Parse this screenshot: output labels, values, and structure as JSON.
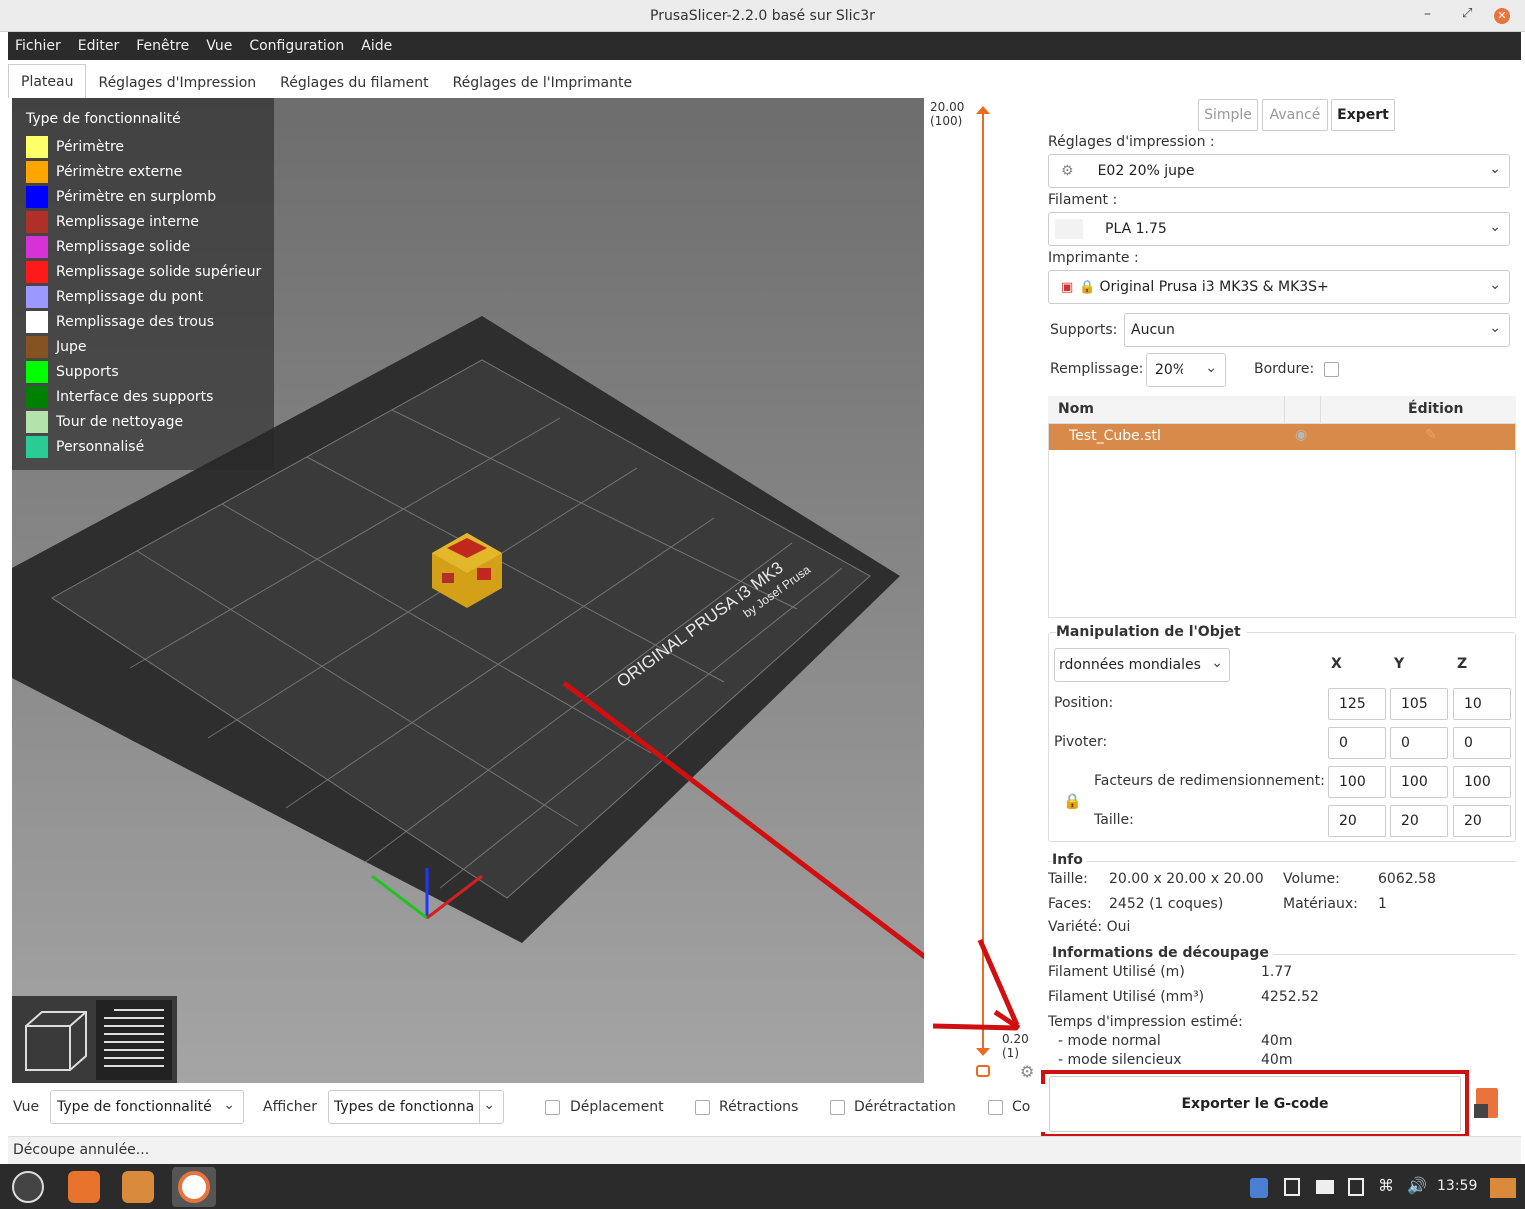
{
  "window": {
    "title": "PrusaSlicer-2.2.0 basé sur Slic3r",
    "min": "–",
    "max": "⤢",
    "close": "✕"
  },
  "menu": [
    "Fichier",
    "Editer",
    "Fenêtre",
    "Vue",
    "Configuration",
    "Aide"
  ],
  "tabs": [
    "Plateau",
    "Réglages d'Impression",
    "Réglages du filament",
    "Réglages de l'Imprimante"
  ],
  "legend": {
    "title": "Type de fonctionnalité",
    "items": [
      {
        "label": "Périmètre",
        "color": "#ffff66"
      },
      {
        "label": "Périmètre externe",
        "color": "#ffa500"
      },
      {
        "label": "Périmètre en surplomb",
        "color": "#0000ff"
      },
      {
        "label": "Remplissage interne",
        "color": "#b03029"
      },
      {
        "label": "Remplissage solide",
        "color": "#d633d6"
      },
      {
        "label": "Remplissage solide supérieur",
        "color": "#ff1a1a"
      },
      {
        "label": "Remplissage du pont",
        "color": "#9999ff"
      },
      {
        "label": "Remplissage des trous",
        "color": "#ffffff"
      },
      {
        "label": "Jupe",
        "color": "#845321"
      },
      {
        "label": "Supports",
        "color": "#00ff00"
      },
      {
        "label": "Interface des supports",
        "color": "#008000"
      },
      {
        "label": "Tour de nettoyage",
        "color": "#b3e3ab"
      },
      {
        "label": "Personnalisé",
        "color": "#28cc94"
      }
    ]
  },
  "bed": {
    "label_main": "ORIGINAL PRUSA i3 MK3",
    "label_sub": "by Josef Prusa"
  },
  "slider": {
    "top_value": "20.00",
    "top_layer": "(100)",
    "bottom_value": "0.20",
    "bottom_layer": "(1)"
  },
  "mode": {
    "simple": "Simple",
    "advanced": "Avancé",
    "expert": "Expert"
  },
  "print_settings": {
    "label": "Réglages d'impression :",
    "value": "E02 20% jupe"
  },
  "filament": {
    "label": "Filament :",
    "value": "PLA 1.75"
  },
  "printer": {
    "label": "Imprimante :",
    "value": "Original Prusa i3 MK3S & MK3S+"
  },
  "supports": {
    "label": "Supports:",
    "value": "Aucun"
  },
  "infill": {
    "label": "Remplissage:",
    "value": "20%"
  },
  "brim": {
    "label": "Bordure:"
  },
  "objects": {
    "col_name": "Nom",
    "col_edit": "Édition",
    "rows": [
      {
        "name": "Test_Cube.stl"
      }
    ]
  },
  "manip": {
    "title": "Manipulation de l'Objet",
    "coords": "rdonnées mondiales",
    "x": "X",
    "y": "Y",
    "z": "Z",
    "position": {
      "label": "Position:",
      "x": "125",
      "y": "105",
      "z": "10"
    },
    "rotate": {
      "label": "Pivoter:",
      "x": "0",
      "y": "0",
      "z": "0"
    },
    "scale": {
      "label": "Facteurs de redimensionnement:",
      "x": "100",
      "y": "100",
      "z": "100"
    },
    "size": {
      "label": "Taille:",
      "x": "20",
      "y": "20",
      "z": "20"
    }
  },
  "info": {
    "title": "Info",
    "size_label": "Taille:",
    "size_value": "20.00 x 20.00 x 20.00",
    "volume_label": "Volume:",
    "volume_value": "6062.58",
    "faces_label": "Faces:",
    "faces_value": "2452 (1 coques)",
    "materials_label": "Matériaux:",
    "materials_value": "1",
    "manifold": "Variété: Oui"
  },
  "slice_info": {
    "title": "Informations de découpage",
    "fil_m_label": "Filament Utilisé (m)",
    "fil_m_value": "1.77",
    "fil_mm3_label": "Filament Utilisé (mm³)",
    "fil_mm3_value": "4252.52",
    "time_label": "Temps d'impression estimé:",
    "normal_label": "- mode normal",
    "normal_value": "40m",
    "silent_label": "- mode silencieux",
    "silent_value": "40m"
  },
  "export": {
    "label": "Exporter le G-code"
  },
  "bottom": {
    "view_label": "Vue",
    "view_value": "Type de fonctionnalité",
    "show_label": "Afficher",
    "show_value": "Types de fonctionna",
    "travel": "Déplacement",
    "retractions": "Rétractions",
    "deretraction": "Dérétractation",
    "more": "Co"
  },
  "status": "Découpe annulée...",
  "taskbar": {
    "clock": "13:59"
  }
}
